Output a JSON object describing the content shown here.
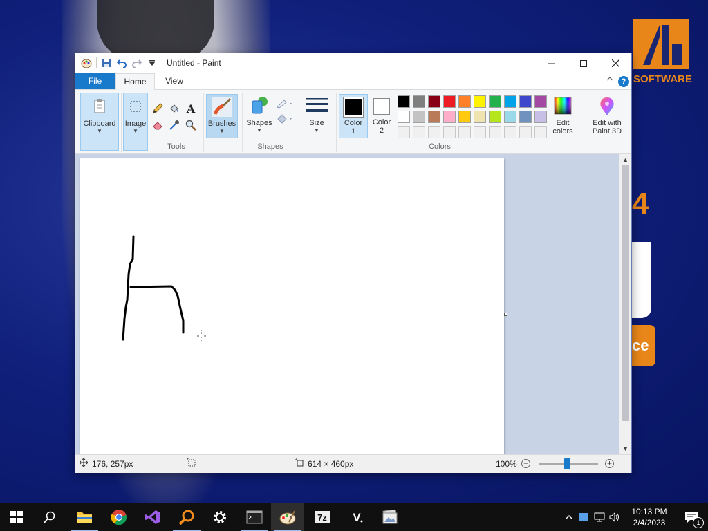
{
  "window": {
    "title": "Untitled - Paint"
  },
  "tabs": [
    {
      "label": "File"
    },
    {
      "label": "Home"
    },
    {
      "label": "View"
    }
  ],
  "ribbon": {
    "clipboard_label": "Clipboard",
    "image_label": "Image",
    "tools_group": "Tools",
    "brushes_label": "Brushes",
    "shapes_label": "Shapes",
    "shapes_group": "Shapes",
    "size_label": "Size",
    "color1_label_line1": "Color",
    "color1_label_line2": "1",
    "color2_label_line1": "Color",
    "color2_label_line2": "2",
    "colors_group": "Colors",
    "edit_colors_line1": "Edit",
    "edit_colors_line2": "colors",
    "paint3d_line1": "Edit with",
    "paint3d_line2": "Paint 3D",
    "color1_value": "#000000",
    "color2_value": "#ffffff",
    "palette_row1": [
      "#000000",
      "#7f7f7f",
      "#880015",
      "#ed1c24",
      "#ff7f27",
      "#fff200",
      "#22b14c",
      "#00a2e8",
      "#3f48cc",
      "#a349a4"
    ],
    "palette_row2": [
      "#ffffff",
      "#c3c3c3",
      "#b97a57",
      "#ffaec9",
      "#ffc90e",
      "#efe4b0",
      "#b5e61d",
      "#99d9ea",
      "#7092be",
      "#c8bfe7"
    ]
  },
  "status": {
    "cursor_pos": "176, 257px",
    "canvas_size": "614 × 460px",
    "zoom": "100%"
  },
  "taskbar": {
    "time": "10:13 PM",
    "date": "2/4/2023",
    "notification_count": "1"
  },
  "wallpaper": {
    "logo_text": "SOFTWARE",
    "side_text_1": "4",
    "side_text_2": "ce"
  }
}
